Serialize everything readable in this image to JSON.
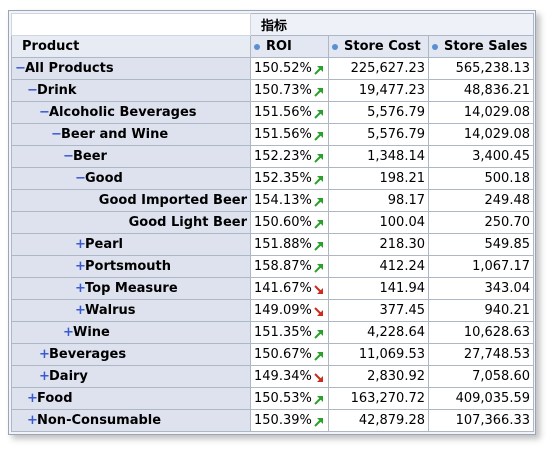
{
  "header": {
    "title": "指标",
    "dimension_label": "Product",
    "measures": [
      "ROI",
      "Store Cost",
      "Store Sales"
    ]
  },
  "icons": {
    "expanded": "minus-icon",
    "collapsed": "plus-icon",
    "trend_up": "arrow-up-right-icon",
    "trend_down": "arrow-down-right-icon",
    "up_color": "#2ca02c",
    "down_color": "#cc2b1f"
  },
  "rows": [
    {
      "label": "All Products",
      "level": 0,
      "toggle": "-",
      "roi": "150.52%",
      "trend": "up",
      "cost": "225,627.23",
      "sales": "565,238.13"
    },
    {
      "label": "Drink",
      "level": 1,
      "toggle": "-",
      "roi": "150.73%",
      "trend": "up",
      "cost": "19,477.23",
      "sales": "48,836.21"
    },
    {
      "label": "Alcoholic Beverages",
      "level": 2,
      "toggle": "-",
      "roi": "151.56%",
      "trend": "up",
      "cost": "5,576.79",
      "sales": "14,029.08"
    },
    {
      "label": "Beer and Wine",
      "level": 3,
      "toggle": "-",
      "roi": "151.56%",
      "trend": "up",
      "cost": "5,576.79",
      "sales": "14,029.08"
    },
    {
      "label": "Beer",
      "level": 4,
      "toggle": "-",
      "roi": "152.23%",
      "trend": "up",
      "cost": "1,348.14",
      "sales": "3,400.45"
    },
    {
      "label": "Good",
      "level": 5,
      "toggle": "-",
      "roi": "152.35%",
      "trend": "up",
      "cost": "198.21",
      "sales": "500.18"
    },
    {
      "label": "Good Imported Beer",
      "level": 6,
      "toggle": "",
      "roi": "154.13%",
      "trend": "up",
      "cost": "98.17",
      "sales": "249.48"
    },
    {
      "label": "Good Light Beer",
      "level": 6,
      "toggle": "",
      "roi": "150.60%",
      "trend": "up",
      "cost": "100.04",
      "sales": "250.70"
    },
    {
      "label": "Pearl",
      "level": 5,
      "toggle": "+",
      "roi": "151.88%",
      "trend": "up",
      "cost": "218.30",
      "sales": "549.85"
    },
    {
      "label": "Portsmouth",
      "level": 5,
      "toggle": "+",
      "roi": "158.87%",
      "trend": "up",
      "cost": "412.24",
      "sales": "1,067.17"
    },
    {
      "label": "Top Measure",
      "level": 5,
      "toggle": "+",
      "roi": "141.67%",
      "trend": "down",
      "cost": "141.94",
      "sales": "343.04"
    },
    {
      "label": "Walrus",
      "level": 5,
      "toggle": "+",
      "roi": "149.09%",
      "trend": "down",
      "cost": "377.45",
      "sales": "940.21"
    },
    {
      "label": "Wine",
      "level": 4,
      "toggle": "+",
      "roi": "151.35%",
      "trend": "up",
      "cost": "4,228.64",
      "sales": "10,628.63"
    },
    {
      "label": "Beverages",
      "level": 2,
      "toggle": "+",
      "roi": "150.67%",
      "trend": "up",
      "cost": "11,069.53",
      "sales": "27,748.53"
    },
    {
      "label": "Dairy",
      "level": 2,
      "toggle": "+",
      "roi": "149.34%",
      "trend": "down",
      "cost": "2,830.92",
      "sales": "7,058.60"
    },
    {
      "label": "Food",
      "level": 1,
      "toggle": "+",
      "roi": "150.53%",
      "trend": "up",
      "cost": "163,270.72",
      "sales": "409,035.59"
    },
    {
      "label": "Non-Consumable",
      "level": 1,
      "toggle": "+",
      "roi": "150.39%",
      "trend": "up",
      "cost": "42,879.28",
      "sales": "107,366.33"
    }
  ]
}
